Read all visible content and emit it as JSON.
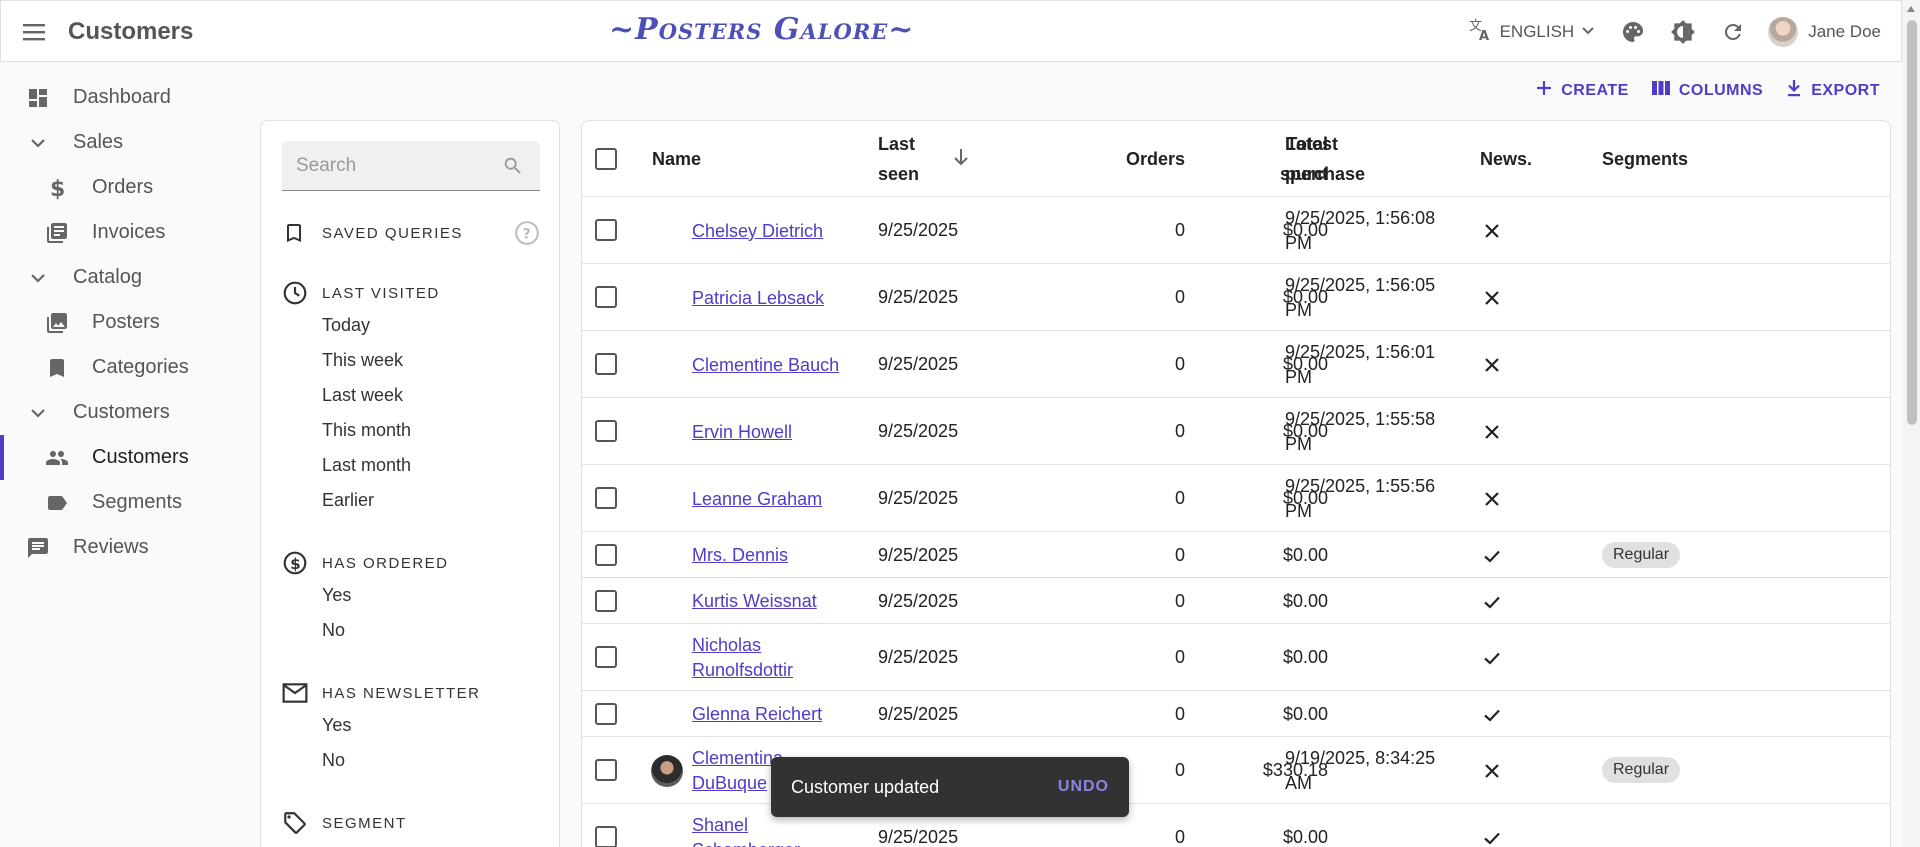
{
  "appbar": {
    "title": "Customers",
    "brand": "~Posters Galore~",
    "language": "ENGLISH",
    "user_name": "Jane Doe"
  },
  "sidebar": {
    "items": [
      {
        "label": "Dashboard",
        "icon": "dashboard-icon"
      },
      {
        "label": "Sales",
        "icon": "chevron-down-icon"
      },
      {
        "label": "Orders",
        "icon": "dollar-icon"
      },
      {
        "label": "Invoices",
        "icon": "invoice-icon"
      },
      {
        "label": "Catalog",
        "icon": "chevron-down-icon"
      },
      {
        "label": "Posters",
        "icon": "image-icon"
      },
      {
        "label": "Categories",
        "icon": "bookmark-icon"
      },
      {
        "label": "Customers",
        "icon": "chevron-down-icon"
      },
      {
        "label": "Customers",
        "icon": "people-icon"
      },
      {
        "label": "Segments",
        "icon": "label-icon"
      },
      {
        "label": "Reviews",
        "icon": "comment-icon"
      }
    ]
  },
  "filter": {
    "search_placeholder": "Search",
    "saved_queries": "SAVED QUERIES",
    "last_visited": {
      "title": "LAST VISITED",
      "options": [
        "Today",
        "This week",
        "Last week",
        "This month",
        "Last month",
        "Earlier"
      ]
    },
    "has_ordered": {
      "title": "HAS ORDERED",
      "options": [
        "Yes",
        "No"
      ]
    },
    "has_newsletter": {
      "title": "HAS NEWSLETTER",
      "options": [
        "Yes",
        "No"
      ]
    },
    "segment": {
      "title": "SEGMENT"
    }
  },
  "toolbar": {
    "create": "CREATE",
    "columns": "COLUMNS",
    "export": "EXPORT"
  },
  "table": {
    "headers": {
      "name": "Name",
      "last_seen_1": "Last",
      "last_seen_2": "seen",
      "orders": "Orders",
      "total_spent_1": "Total",
      "total_spent_2": "spent",
      "latest_purchase_1": "Latest",
      "latest_purchase_2": "purchase",
      "news": "News.",
      "segments": "Segments"
    },
    "rows": [
      {
        "name1": "Chelsey Dietrich",
        "name2": "",
        "last_seen": "9/25/2025",
        "orders": "0",
        "total": "$0.00",
        "latest1": "9/25/2025, 1:56:08",
        "latest2": "PM",
        "news": "cross",
        "segment": ""
      },
      {
        "name1": "Patricia Lebsack",
        "name2": "",
        "last_seen": "9/25/2025",
        "orders": "0",
        "total": "$0.00",
        "latest1": "9/25/2025, 1:56:05",
        "latest2": "PM",
        "news": "cross",
        "segment": ""
      },
      {
        "name1": "Clementine Bauch",
        "name2": "",
        "last_seen": "9/25/2025",
        "orders": "0",
        "total": "$0.00",
        "latest1": "9/25/2025, 1:56:01",
        "latest2": "PM",
        "news": "cross",
        "segment": ""
      },
      {
        "name1": "Ervin Howell",
        "name2": "",
        "last_seen": "9/25/2025",
        "orders": "0",
        "total": "$0.00",
        "latest1": "9/25/2025, 1:55:58",
        "latest2": "PM",
        "news": "cross",
        "segment": ""
      },
      {
        "name1": "Leanne Graham",
        "name2": "",
        "last_seen": "9/25/2025",
        "orders": "0",
        "total": "$0.00",
        "latest1": "9/25/2025, 1:55:56",
        "latest2": "PM",
        "news": "cross",
        "segment": ""
      },
      {
        "name1": "Mrs. Dennis",
        "name2": "",
        "last_seen": "9/25/2025",
        "orders": "0",
        "total": "$0.00",
        "latest1": "",
        "latest2": "",
        "news": "check",
        "segment": "Regular"
      },
      {
        "name1": "Kurtis Weissnat",
        "name2": "",
        "last_seen": "9/25/2025",
        "orders": "0",
        "total": "$0.00",
        "latest1": "",
        "latest2": "",
        "news": "check",
        "segment": ""
      },
      {
        "name1": "Nicholas",
        "name2": "Runolfsdottir",
        "last_seen": "9/25/2025",
        "orders": "0",
        "total": "$0.00",
        "latest1": "",
        "latest2": "",
        "news": "check",
        "segment": ""
      },
      {
        "name1": "Glenna Reichert",
        "name2": "",
        "last_seen": "9/25/2025",
        "orders": "0",
        "total": "$0.00",
        "latest1": "",
        "latest2": "",
        "news": "check",
        "segment": ""
      },
      {
        "name1": "Clementina",
        "name2": "DuBuque",
        "last_seen": "9/25/2025",
        "orders": "0",
        "total": "$330.18",
        "latest1": "9/19/2025, 8:34:25",
        "latest2": "AM",
        "news": "cross",
        "segment": "Regular"
      },
      {
        "name1": "Shanel",
        "name2": "Schamberger",
        "last_seen": "9/25/2025",
        "orders": "0",
        "total": "$0.00",
        "latest1": "",
        "latest2": "",
        "news": "check",
        "segment": ""
      }
    ]
  },
  "snackbar": {
    "message": "Customer updated",
    "action": "UNDO"
  }
}
